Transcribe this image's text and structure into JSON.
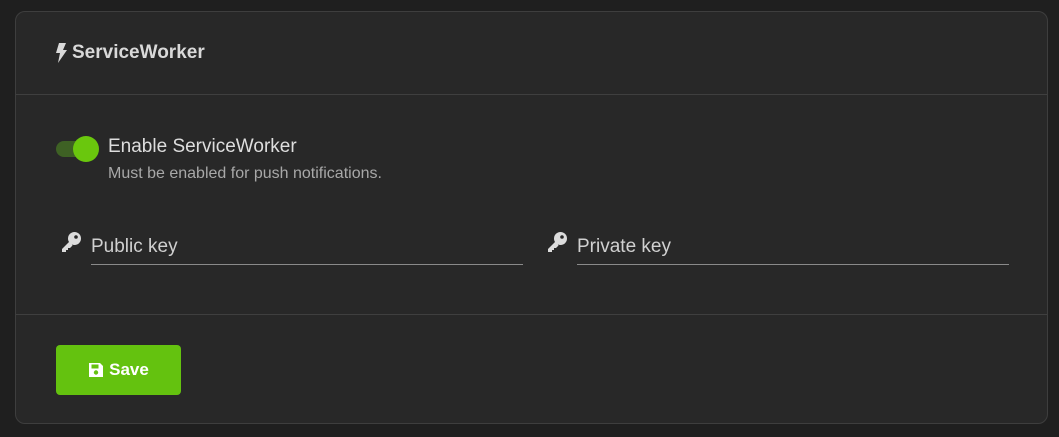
{
  "panel": {
    "title": "ServiceWorker",
    "title_icon": "bolt-icon"
  },
  "toggle": {
    "label": "Enable ServiceWorker",
    "help": "Must be enabled for push notifications.",
    "checked": true,
    "on_color": "#6ac70d"
  },
  "fields": {
    "public_key": {
      "placeholder": "Public key",
      "value": "",
      "icon": "key-icon"
    },
    "private_key": {
      "placeholder": "Private key",
      "value": "",
      "icon": "key-icon"
    }
  },
  "footer": {
    "save_label": "Save",
    "save_icon": "floppy-disk-icon",
    "save_color": "#64c20f"
  }
}
